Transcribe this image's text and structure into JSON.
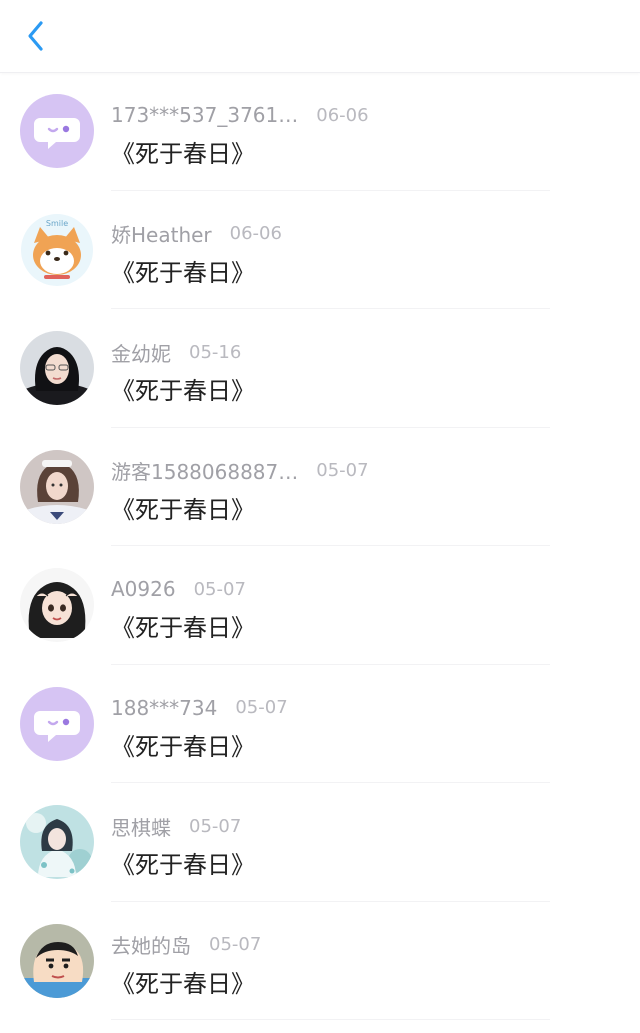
{
  "header": {
    "back_icon": "chevron-left-icon",
    "accent_color": "#2b9af3"
  },
  "items": [
    {
      "username": "173***537_3761…",
      "date": "06-06",
      "title": "《死于春日》",
      "avatar": "default-chat-avatar"
    },
    {
      "username": "娇Heather",
      "date": "06-06",
      "title": "《死于春日》",
      "avatar": "shiba-smile-avatar"
    },
    {
      "username": "金幼妮",
      "date": "05-16",
      "title": "《死于春日》",
      "avatar": "photo-avatar"
    },
    {
      "username": "游客1588068887…",
      "date": "05-07",
      "title": "《死于春日》",
      "avatar": "photo-avatar"
    },
    {
      "username": "A0926",
      "date": "05-07",
      "title": "《死于春日》",
      "avatar": "cartoon-girl-avatar"
    },
    {
      "username": "188***734",
      "date": "05-07",
      "title": "《死于春日》",
      "avatar": "default-chat-avatar"
    },
    {
      "username": "思棋蝶",
      "date": "05-07",
      "title": "《死于春日》",
      "avatar": "anime-avatar"
    },
    {
      "username": "去她的岛",
      "date": "05-07",
      "title": "《死于春日》",
      "avatar": "cartoon-boy-avatar"
    }
  ]
}
